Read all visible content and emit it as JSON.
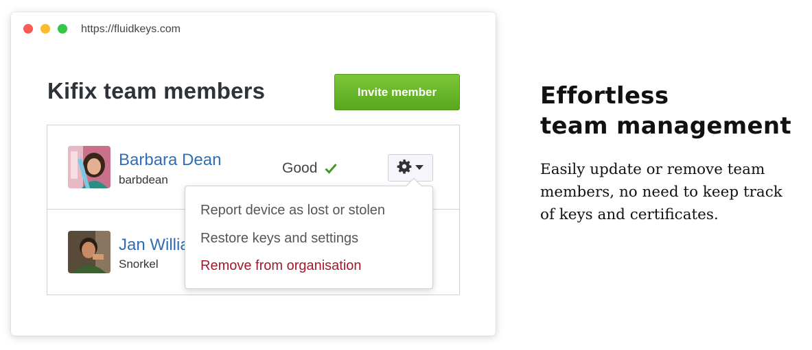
{
  "browser": {
    "url": "https://fluidkeys.com"
  },
  "team": {
    "title": "Kifix team members",
    "invite_label": "Invite member"
  },
  "members": [
    {
      "name": "Barbara Dean",
      "username": "barbdean",
      "status": "Good",
      "status_icon": "check-icon"
    },
    {
      "name": "Jan Willia",
      "username": "Snorkel"
    }
  ],
  "dropdown": {
    "items": [
      {
        "label": "Report device as lost or stolen"
      },
      {
        "label": "Restore keys and settings"
      },
      {
        "label": "Remove from organisation"
      }
    ]
  },
  "marketing": {
    "heading_line1": "Effortless",
    "heading_line2": "team management",
    "description": "Easily update or remove team members, no need to keep track of keys and certificates."
  },
  "colors": {
    "invite_button": "#6bb62a",
    "member_name": "#2f6db5",
    "danger": "#a3182c",
    "status_check": "#3e9a1e"
  }
}
